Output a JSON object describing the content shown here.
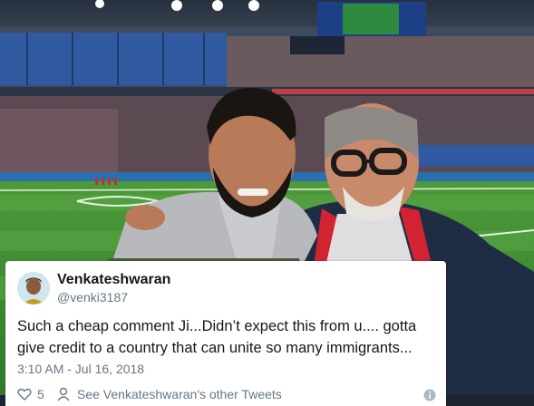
{
  "tweet": {
    "display_name": "Venkateshwaran",
    "handle": "@venki3187",
    "text": "Such a cheap comment Ji...Didn’t expect this from u.... gotta give credit to a country that can unite so many immigrants...",
    "timestamp": "3:10 AM - Jul 16, 2018",
    "likes": "5",
    "other_tweets_label": "See Venkateshwaran's other Tweets"
  },
  "colors": {
    "text_primary": "#14171a",
    "text_secondary": "#657786",
    "pitch_green": "#3f8a32",
    "stands_blue": "#2f5aa0"
  },
  "icons": [
    "like-icon",
    "person-icon",
    "info-icon"
  ]
}
